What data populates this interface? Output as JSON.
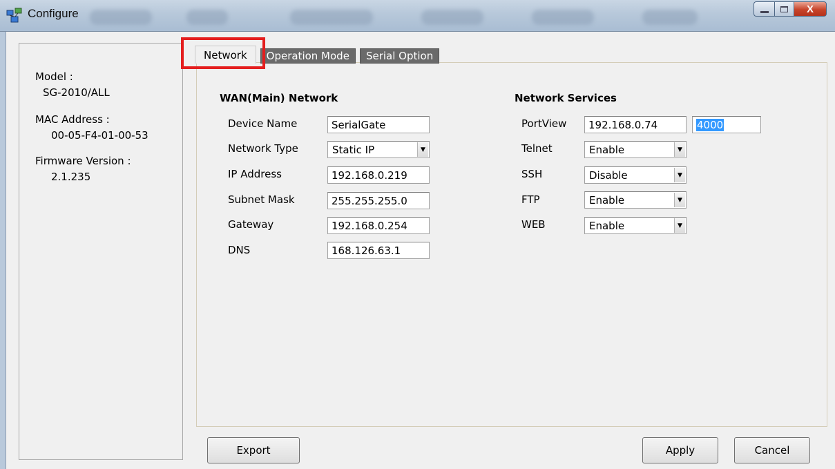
{
  "window": {
    "title": "Configure",
    "minimize_icon": "minimize-icon",
    "maximize_icon": "maximize-icon",
    "close_icon": "close-icon",
    "close_glyph": "X"
  },
  "device_info": {
    "model_label": "Model :",
    "model_value": "SG-2010/ALL",
    "mac_label": "MAC Address :",
    "mac_value": "00-05-F4-01-00-53",
    "firmware_label": "Firmware Version :",
    "firmware_value": "2.1.235"
  },
  "tabs": [
    {
      "label": "Network",
      "active": true
    },
    {
      "label": "Operation Mode",
      "active": false
    },
    {
      "label": "Serial Option",
      "active": false
    }
  ],
  "highlight_color": "#e41e1e",
  "wan": {
    "title": "WAN(Main) Network",
    "device_name_label": "Device Name",
    "device_name_value": "SerialGate",
    "network_type_label": "Network Type",
    "network_type_value": "Static IP",
    "ip_label": "IP Address",
    "ip_value": "192.168.0.219",
    "subnet_label": "Subnet Mask",
    "subnet_value": "255.255.255.0",
    "gateway_label": "Gateway",
    "gateway_value": "192.168.0.254",
    "dns_label": "DNS",
    "dns_value": "168.126.63.1"
  },
  "services": {
    "title": "Network Services",
    "portview_label": "PortView",
    "portview_ip": "192.168.0.74",
    "portview_port": "4000",
    "telnet_label": "Telnet",
    "telnet_value": "Enable",
    "ssh_label": "SSH",
    "ssh_value": "Disable",
    "ftp_label": "FTP",
    "ftp_value": "Enable",
    "web_label": "WEB",
    "web_value": "Enable"
  },
  "buttons": {
    "export": "Export",
    "apply": "Apply",
    "cancel": "Cancel"
  }
}
